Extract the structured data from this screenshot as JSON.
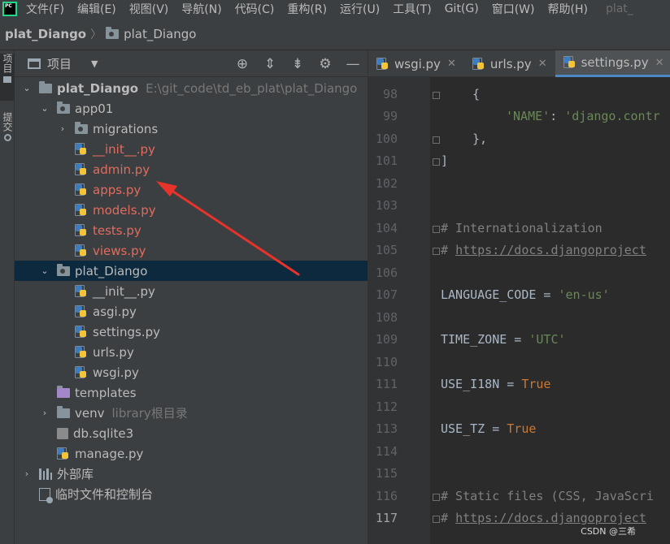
{
  "menubar": {
    "items": [
      "文件(F)",
      "编辑(E)",
      "视图(V)",
      "导航(N)",
      "代码(C)",
      "重构(R)",
      "运行(U)",
      "工具(T)",
      "Git(G)",
      "窗口(W)",
      "帮助(H)"
    ],
    "title": "plat_"
  },
  "breadcrumb": {
    "root": "plat_Diango",
    "folder": "plat_Diango"
  },
  "toolstrip": {
    "project_tab": "项目",
    "commit_tab": "提交"
  },
  "project_panel": {
    "title": "项目",
    "tree": [
      {
        "label": "plat_Diango",
        "hint": "E:\\git_code\\td_eb_plat\\plat_Diango"
      },
      {
        "label": "app01"
      },
      {
        "label": "migrations"
      },
      {
        "label": "__init__.py"
      },
      {
        "label": "admin.py"
      },
      {
        "label": "apps.py"
      },
      {
        "label": "models.py"
      },
      {
        "label": "tests.py"
      },
      {
        "label": "views.py"
      },
      {
        "label": "plat_Diango"
      },
      {
        "label": "__init__.py"
      },
      {
        "label": "asgi.py"
      },
      {
        "label": "settings.py"
      },
      {
        "label": "urls.py"
      },
      {
        "label": "wsgi.py"
      },
      {
        "label": "templates"
      },
      {
        "label": "venv",
        "hint": "library根目录"
      },
      {
        "label": "db.sqlite3"
      },
      {
        "label": "manage.py"
      },
      {
        "label": "外部库"
      },
      {
        "label": "临时文件和控制台"
      }
    ]
  },
  "editor": {
    "tabs": [
      {
        "label": "wsgi.py"
      },
      {
        "label": "urls.py"
      },
      {
        "label": "settings.py"
      }
    ],
    "line_numbers": [
      "98",
      "99",
      "100",
      "101",
      "102",
      "103",
      "104",
      "105",
      "106",
      "107",
      "108",
      "109",
      "110",
      "111",
      "112",
      "113",
      "114",
      "115",
      "116",
      "117"
    ],
    "code": {
      "l98_brace": "{",
      "l99_key": "'NAME'",
      "l99_colon": ": ",
      "l99_val": "'django.contr",
      "l100_brace": "},",
      "l101_bracket": "]",
      "l104_comment": "# Internationalization",
      "l105_hash": "# ",
      "l105_link": "https://docs.djangoproject",
      "l107_name": "LANGUAGE_CODE = ",
      "l107_val": "'en-us'",
      "l109_name": "TIME_ZONE = ",
      "l109_val": "'UTC'",
      "l111_name": "USE_I18N = ",
      "l111_val": "True",
      "l113_name": "USE_TZ = ",
      "l113_val": "True",
      "l116_comment": "# Static files (CSS, JavaScri",
      "l117_hash": "# ",
      "l117_link": "https://docs.djangoproject"
    }
  },
  "watermark": "CSDN @三希",
  "colors": {
    "modified_file": "#e06c5f",
    "annotation_arrow": "#e8332a",
    "selection": "#0d293e"
  }
}
